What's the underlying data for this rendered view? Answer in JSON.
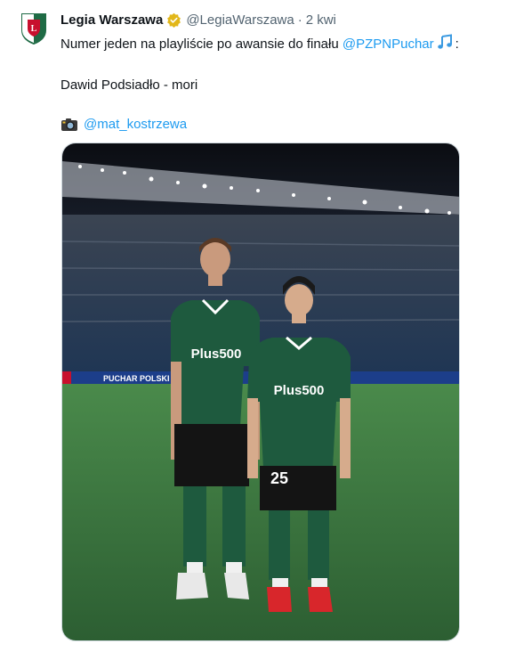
{
  "tweet": {
    "author_name": "Legia Warszawa",
    "handle": "@LegiaWarszawa",
    "separator": "·",
    "time": "2 kwi",
    "verified_badge_color": "#e2b719",
    "text_line1_before": "Numer jeden na playliście po awansie do finału ",
    "mention_1": "@PZPNPuchar",
    "text_line1_after": ":",
    "music_icon": "music-note-icon",
    "text_line2": "Dawid Podsiadło - mori",
    "camera_icon": "camera-icon",
    "mention_2": "@mat_kostrzewa"
  },
  "photo": {
    "ad_board_text": "PUCHAR POLSKI",
    "player_left": {
      "sponsor": "Plus500"
    },
    "player_right": {
      "sponsor": "Plus500",
      "number": "25"
    }
  },
  "colors": {
    "mention": "#1d9bf0",
    "text": "#0f1419",
    "secondary": "#536471",
    "kit_green": "#1e5a3e",
    "pitch": "#3d7a40"
  }
}
